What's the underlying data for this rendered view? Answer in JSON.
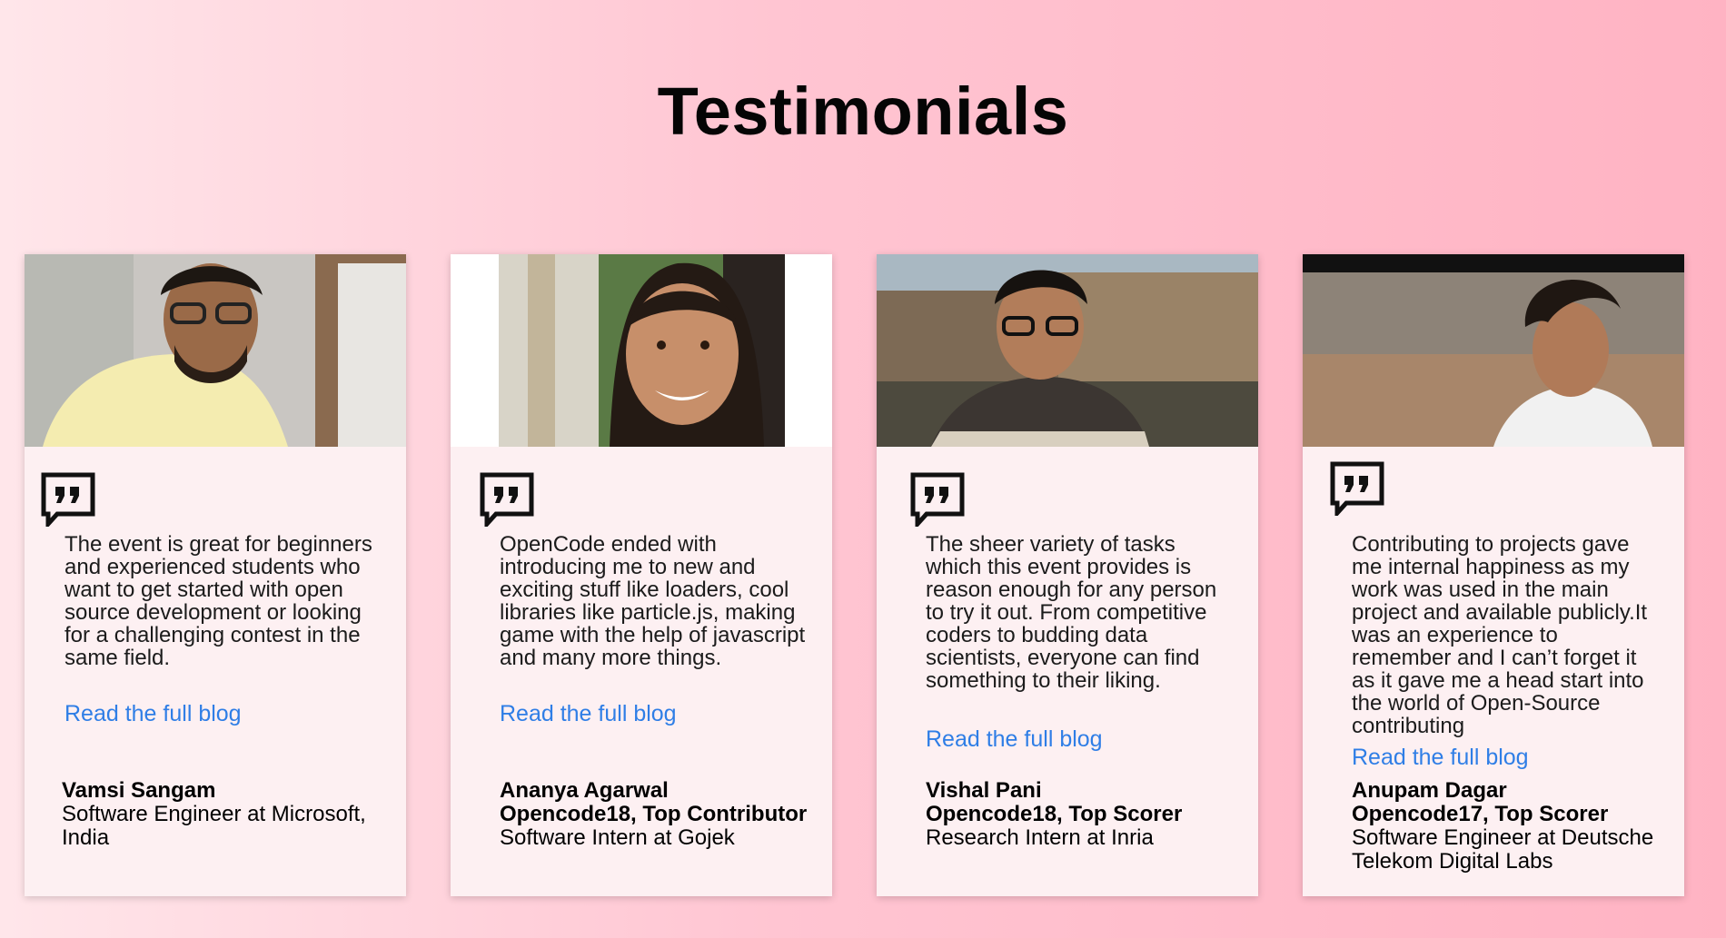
{
  "page": {
    "title": "Testimonials"
  },
  "testimonials": [
    {
      "quote": "The event is great for beginners and experienced students who want to get started with open source development or looking for a challenging contest in the same field.",
      "link": "Read the full blog",
      "name": "Vamsi Sangam",
      "role": "",
      "position": "Software Engineer at Microsoft, India"
    },
    {
      "quote": "OpenCode ended with introducing me to new and exciting stuff like loaders, cool libraries like particle.js, making game with the help of javascript and many more things.",
      "link": "Read the full blog",
      "name": "Ananya Agarwal",
      "role": "Opencode18, Top Contributor",
      "position": "Software Intern at Gojek"
    },
    {
      "quote": "The sheer variety of tasks which this event provides is reason enough for any person to try it out. From competitive coders to budding data scientists, everyone can find something to their liking.",
      "link": "Read the full blog",
      "name": "Vishal Pani",
      "role": "Opencode18, Top Scorer",
      "position": "Research Intern at Inria"
    },
    {
      "quote": "Contributing to projects gave me internal happiness as my work was used in the main project and available publicly.It was an experience to remember and I can’t forget it as it gave me a head start into the world of Open-Source contributing",
      "link": "Read the full blog",
      "name": "Anupam Dagar",
      "role": "Opencode17, Top Scorer",
      "position": "Software Engineer at Deutsche Telekom Digital Labs"
    }
  ],
  "icons": {
    "quote": "quote-bubble-icon"
  },
  "colors": {
    "link": "#2f7ee6",
    "card": "#fdf0f2"
  }
}
